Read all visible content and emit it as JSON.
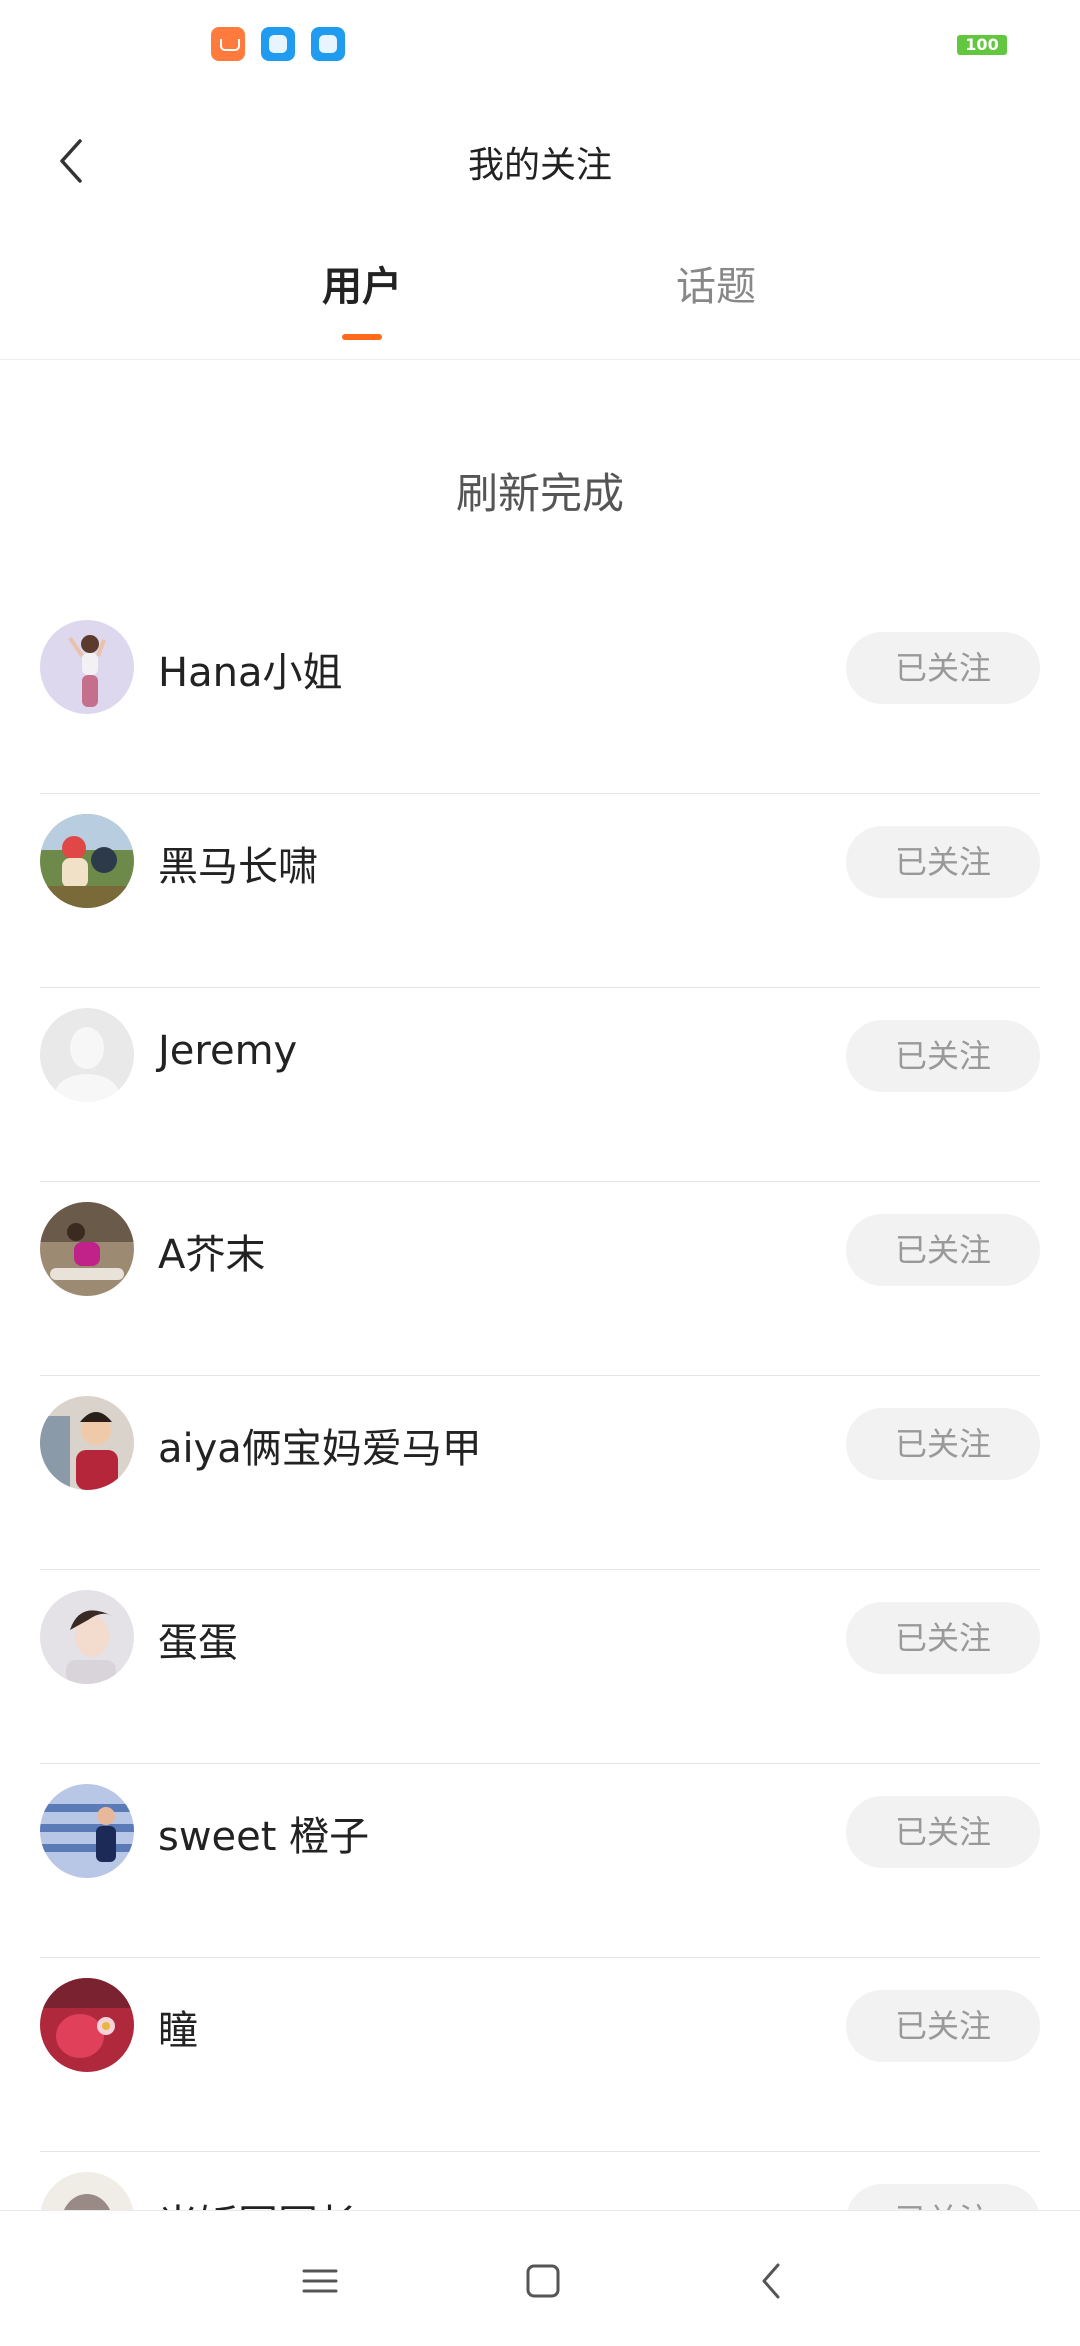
{
  "status_bar": {
    "battery": "100",
    "app_icons": [
      "mi-store-icon",
      "blue-app-icon",
      "blue-app-icon"
    ],
    "battery_color": "#62c73f"
  },
  "header": {
    "title": "我的关注",
    "back_icon": "chevron-left-icon"
  },
  "tabs": [
    {
      "label": "用户",
      "active": true
    },
    {
      "label": "话题",
      "active": false
    }
  ],
  "accent_color": "#ff6a1a",
  "refresh_text": "刷新完成",
  "follow_label": "已关注",
  "users": [
    {
      "name": "Hana小姐",
      "avatar": "avatar-photo"
    },
    {
      "name": "黑马长啸",
      "avatar": "avatar-photo"
    },
    {
      "name": "Jeremy",
      "avatar": "default-avatar"
    },
    {
      "name": "A芥末",
      "avatar": "avatar-photo"
    },
    {
      "name": "aiya俩宝妈爱马甲",
      "avatar": "avatar-photo"
    },
    {
      "name": "蛋蛋",
      "avatar": "avatar-photo"
    },
    {
      "name": "sweet 橙子",
      "avatar": "avatar-photo"
    },
    {
      "name": "瞳",
      "avatar": "avatar-photo"
    },
    {
      "name": "米饭国国长",
      "avatar": "avatar-photo"
    }
  ],
  "users_follow": [
    "已关注",
    "已关注",
    "已关注",
    "已关注",
    "已关注",
    "已关注",
    "已关注",
    "已关注",
    "已关注"
  ],
  "nav_bar": {
    "buttons": [
      "menu-icon",
      "home-icon",
      "back-icon"
    ]
  }
}
